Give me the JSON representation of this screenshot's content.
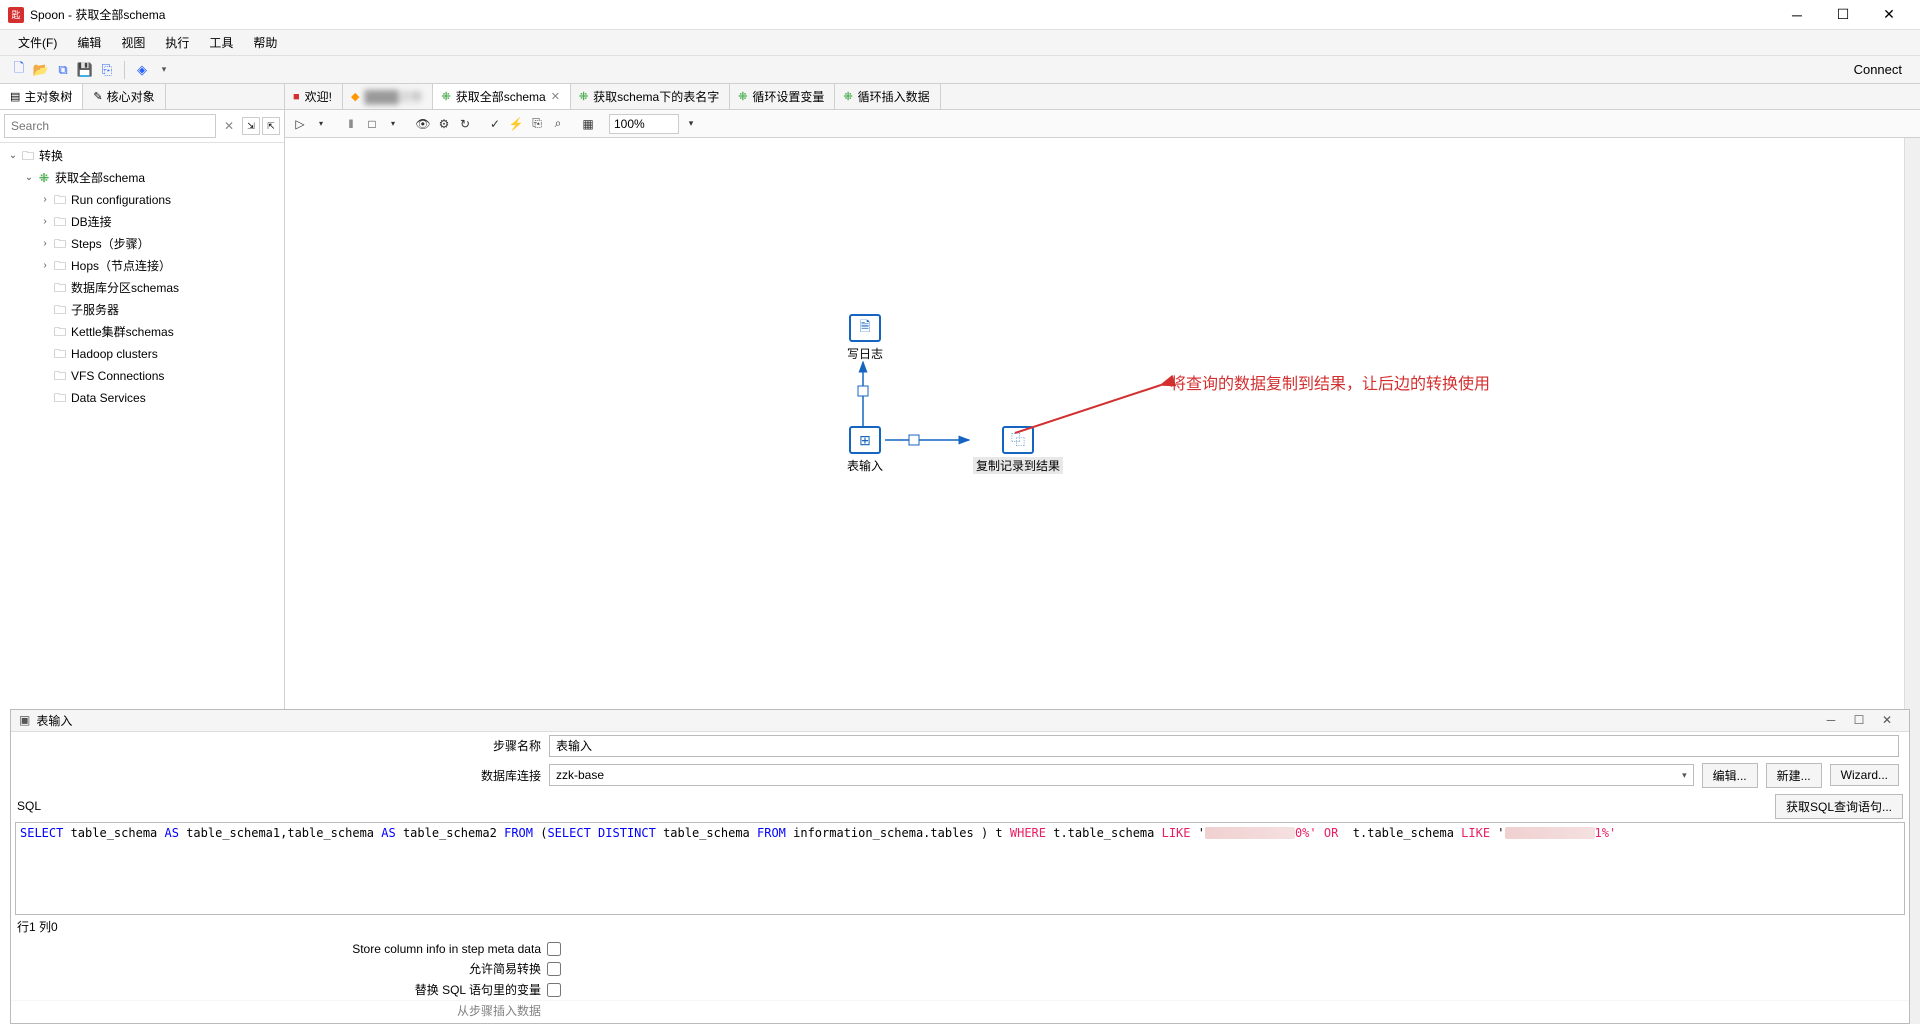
{
  "window": {
    "title": "Spoon - 获取全部schema",
    "app_icon_text": "匙"
  },
  "menubar": [
    "文件(F)",
    "编辑",
    "视图",
    "执行",
    "工具",
    "帮助"
  ],
  "toolbar": {
    "connect": "Connect"
  },
  "sidebar": {
    "tabs": {
      "main": "主对象树",
      "core": "核心对象"
    },
    "search_placeholder": "Search",
    "tree": {
      "root": "转换",
      "trans_name": "获取全部schema",
      "children": [
        "Run configurations",
        "DB连接",
        "Steps（步骤）",
        "Hops（节点连接）",
        "数据库分区schemas",
        "子服务器",
        "Kettle集群schemas",
        "Hadoop clusters",
        "VFS Connections",
        "Data Services"
      ],
      "expandable": [
        true,
        true,
        true,
        true,
        false,
        false,
        false,
        false,
        false,
        false
      ]
    }
  },
  "editor_tabs": [
    {
      "label": "欢迎!",
      "icon": "red"
    },
    {
      "label": "████迁移",
      "icon": "orange",
      "blurred": true
    },
    {
      "label": "获取全部schema",
      "icon": "green",
      "active": true,
      "closable": true
    },
    {
      "label": "获取schema下的表名字",
      "icon": "green"
    },
    {
      "label": "循环设置变量",
      "icon": "green"
    },
    {
      "label": "循环插入数据",
      "icon": "green"
    }
  ],
  "editor_toolbar": {
    "zoom": "100%"
  },
  "canvas": {
    "steps": {
      "log": "写日志",
      "table_input": "表输入",
      "copy_result": "复制记录到结果"
    },
    "annotation": "将查询的数据复制到结果，让后边的转换使用"
  },
  "bottom_panel": {
    "title": "表输入",
    "step_name_label": "步骤名称",
    "step_name_value": "表输入",
    "db_conn_label": "数据库连接",
    "db_conn_value": "zzk-base",
    "btn_edit": "编辑...",
    "btn_new": "新建...",
    "btn_wizard": "Wizard...",
    "sql_label": "SQL",
    "btn_get_sql": "获取SQL查询语句...",
    "sql": {
      "tokens": [
        {
          "t": "SELECT",
          "c": "blue"
        },
        {
          "t": " table_schema "
        },
        {
          "t": "AS",
          "c": "blue"
        },
        {
          "t": " table_schema1,table_schema "
        },
        {
          "t": "AS",
          "c": "blue"
        },
        {
          "t": " table_schema2 "
        },
        {
          "t": "FROM",
          "c": "blue"
        },
        {
          "t": " ("
        },
        {
          "t": "SELECT",
          "c": "blue"
        },
        {
          "t": " "
        },
        {
          "t": "DISTINCT",
          "c": "blue"
        },
        {
          "t": " table_schema "
        },
        {
          "t": "FROM",
          "c": "blue"
        },
        {
          "t": " information_schema.tables ) t "
        },
        {
          "t": "WHERE",
          "c": "magenta"
        },
        {
          "t": " t.table_schema "
        },
        {
          "t": "LIKE",
          "c": "magenta"
        },
        {
          "t": " '"
        },
        {
          "t": "▮▮▮▮▮▮▮▮",
          "c": "obscured"
        },
        {
          "t": "0%'",
          "c": "str"
        },
        {
          "t": " "
        },
        {
          "t": "OR",
          "c": "magenta"
        },
        {
          "t": "  t.table_schema "
        },
        {
          "t": "LIKE",
          "c": "magenta"
        },
        {
          "t": " '"
        },
        {
          "t": "▮▮▮▮▮▮▮▮",
          "c": "obscured"
        },
        {
          "t": "1%'",
          "c": "str"
        }
      ]
    },
    "status_line": "行1 列0",
    "checks": [
      "Store column info in step meta data",
      "允许简易转换",
      "替换 SQL 语句里的变量",
      "从步骤插入数据"
    ]
  }
}
